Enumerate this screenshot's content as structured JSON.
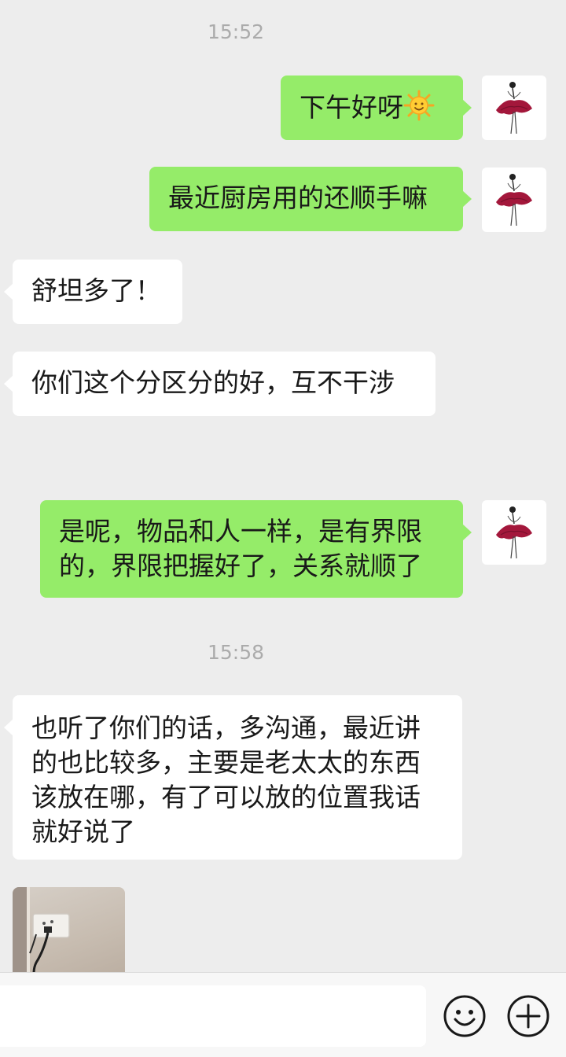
{
  "chat": {
    "timestamps": [
      "15:52",
      "15:58"
    ],
    "messages": [
      {
        "side": "out",
        "text": "下午好呀",
        "emoji": "sun-emoji"
      },
      {
        "side": "out",
        "text": "最近厨房用的还顺手嘛"
      },
      {
        "side": "in",
        "text": "舒坦多了！"
      },
      {
        "side": "in",
        "text": "你们这个分区分的好，互不干涉"
      },
      {
        "side": "out",
        "lines": [
          "是呢，物品和人一样，是有界限",
          "的，界限把握好了，关系就顺了"
        ]
      },
      {
        "side": "in",
        "lines": [
          "也听了你们的话，多沟通，最近讲",
          "的也比较多，主要是老太太的东西",
          "该放在哪，有了可以放的位置我话",
          "就好说了"
        ]
      }
    ],
    "avatar_icon": "ballerina-avatar-icon",
    "photo_icon": "wall-outlet-photo"
  },
  "composer": {
    "input_value": "",
    "emoji_icon": "smiley-face-icon",
    "add_icon": "plus-circle-icon"
  },
  "colors": {
    "background": "#ededed",
    "outgoing_bubble": "#95ec69",
    "incoming_bubble": "#ffffff",
    "timestamp_text": "#ababab",
    "message_text": "#191919"
  }
}
